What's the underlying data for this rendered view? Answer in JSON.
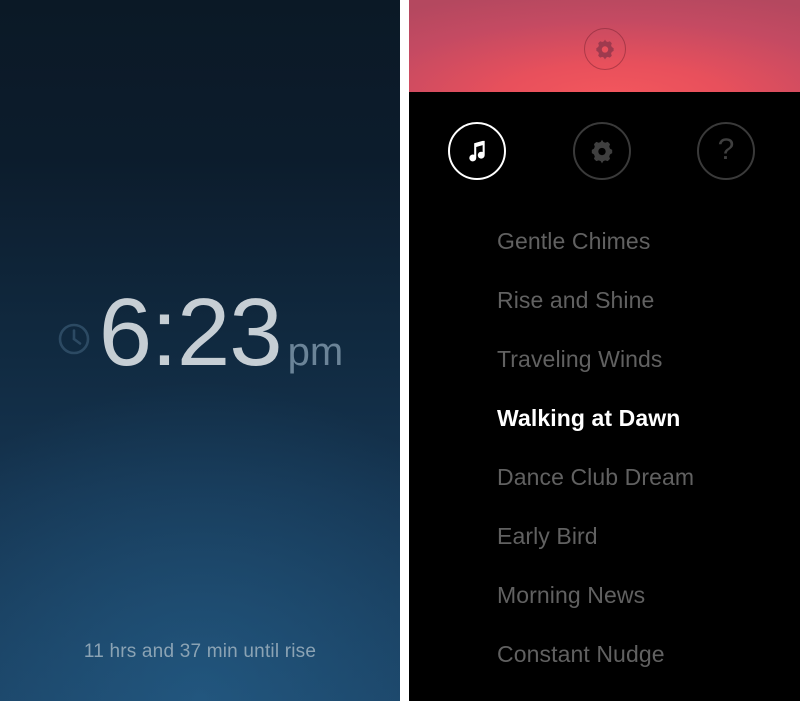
{
  "clock": {
    "icon": "clock-icon",
    "time": "6:23",
    "meridiem": "pm",
    "status": "11 hrs and 37 min until rise",
    "background_top_color": "#0b1926",
    "background_bottom_color": "#1a4061",
    "time_color": "#c6ced4",
    "meridiem_color": "#6b8498",
    "status_color": "#8ba3b4"
  },
  "sound_picker": {
    "header": {
      "icon": "gear-icon",
      "gradient_start": "#b4485f",
      "gradient_end": "#f4575d"
    },
    "tabs": [
      {
        "icon": "music-note-icon",
        "name": "sounds",
        "active": true
      },
      {
        "icon": "gear-icon",
        "name": "settings",
        "active": false
      },
      {
        "icon": "question-mark-icon",
        "name": "help",
        "active": false,
        "glyph": "?"
      }
    ],
    "active_color": "#ffffff",
    "inactive_color": "#3a3a3a",
    "list_text_color": "#616161",
    "selected_text_color": "#ffffff",
    "sounds": [
      {
        "label": "Gentle Chimes",
        "selected": false
      },
      {
        "label": "Rise and Shine",
        "selected": false
      },
      {
        "label": "Traveling Winds",
        "selected": false
      },
      {
        "label": "Walking at Dawn",
        "selected": true
      },
      {
        "label": "Dance Club Dream",
        "selected": false
      },
      {
        "label": "Early Bird",
        "selected": false
      },
      {
        "label": "Morning News",
        "selected": false
      },
      {
        "label": "Constant Nudge",
        "selected": false
      }
    ]
  }
}
